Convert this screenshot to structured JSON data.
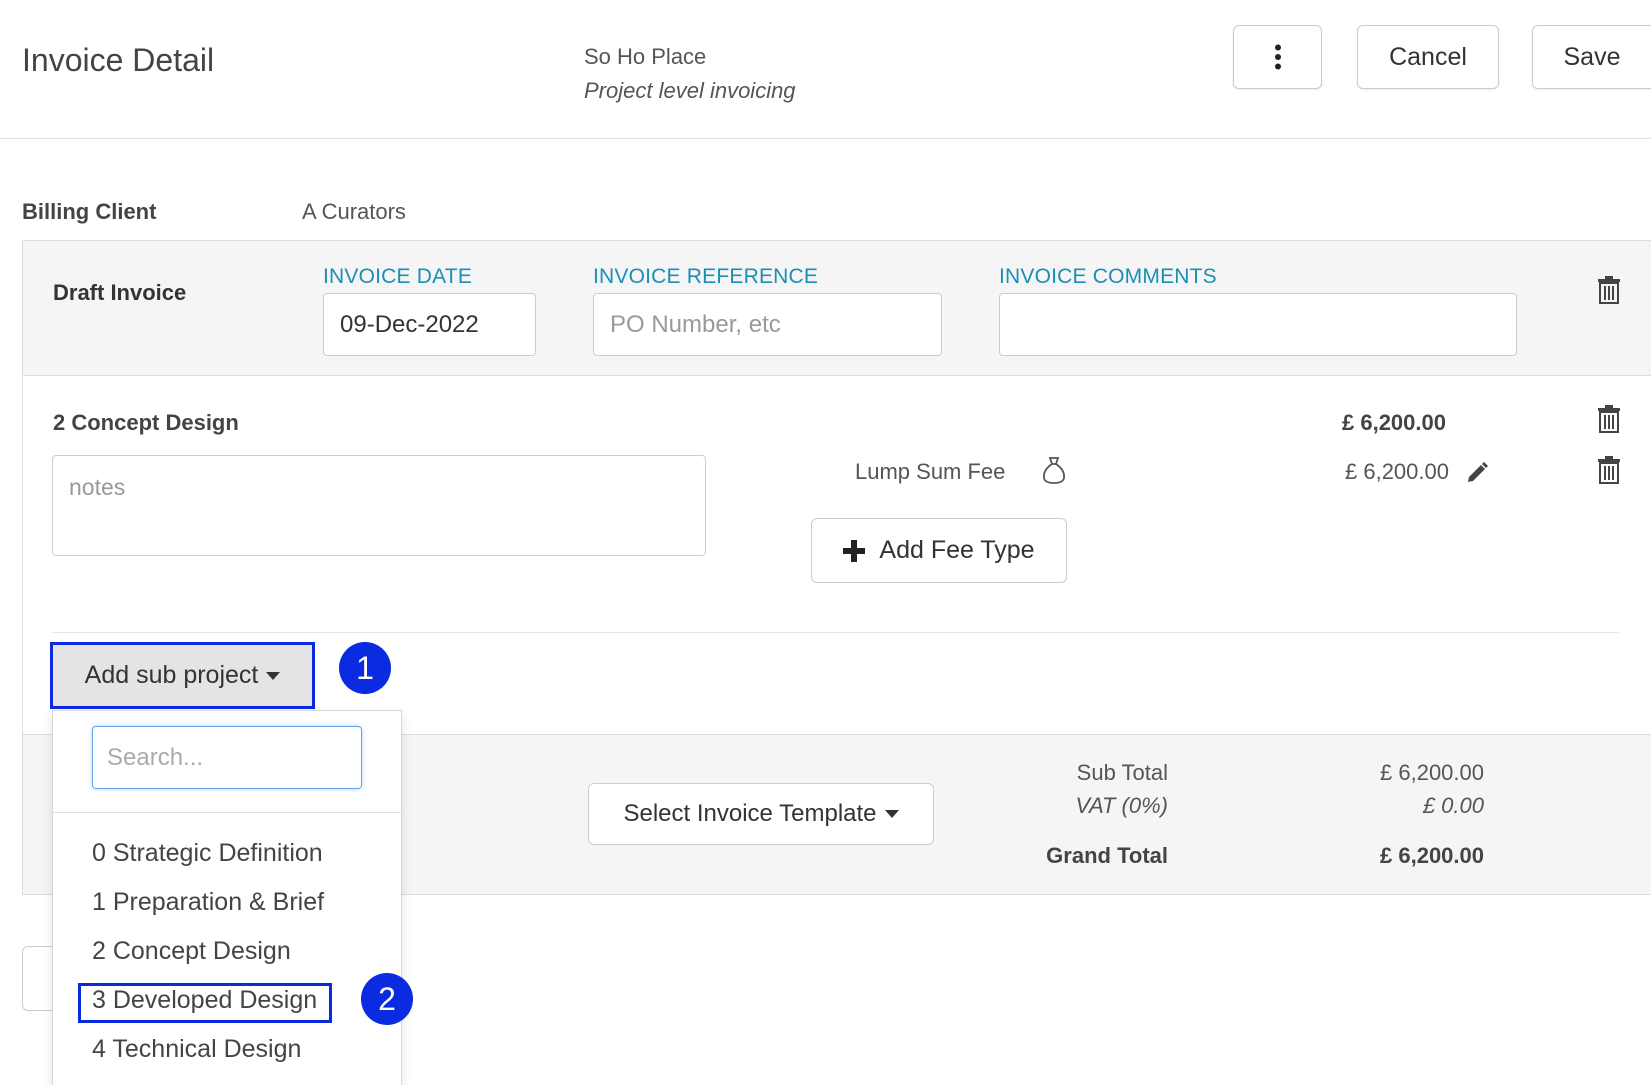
{
  "header": {
    "title": "Invoice Detail",
    "project_name": "So Ho Place",
    "project_subtitle": "Project level invoicing",
    "cancel_label": "Cancel",
    "save_label": "Save"
  },
  "billing": {
    "label": "Billing Client",
    "client": "A Curators"
  },
  "draft": {
    "title": "Draft Invoice",
    "invoice_date_label": "INVOICE DATE",
    "invoice_date_value": "09-Dec-2022",
    "invoice_reference_label": "INVOICE REFERENCE",
    "invoice_reference_placeholder": "PO Number, etc",
    "invoice_comments_label": "INVOICE COMMENTS",
    "invoice_comments_value": ""
  },
  "sub_project": {
    "title": "2 Concept Design",
    "total": "£ 6,200.00",
    "notes_placeholder": "notes",
    "fee_label": "Lump Sum Fee",
    "fee_amount": "£ 6,200.00",
    "add_fee_label": "Add Fee Type"
  },
  "add_sub_project": {
    "label": "Add sub project",
    "search_placeholder": "Search...",
    "options": [
      "0 Strategic Definition",
      "1 Preparation & Brief",
      "2 Concept Design",
      "3 Developed Design",
      "4 Technical Design"
    ]
  },
  "callouts": [
    "1",
    "2"
  ],
  "template": {
    "label": "Select Invoice Template"
  },
  "totals": {
    "sub_total_label": "Sub Total",
    "sub_total_value": "£ 6,200.00",
    "vat_label": "VAT (0%)",
    "vat_value": "£ 0.00",
    "grand_total_label": "Grand Total",
    "grand_total_value": "£ 6,200.00"
  },
  "colors": {
    "accent_label": "#1a8fb5",
    "annotation_blue": "#0a2be0"
  }
}
